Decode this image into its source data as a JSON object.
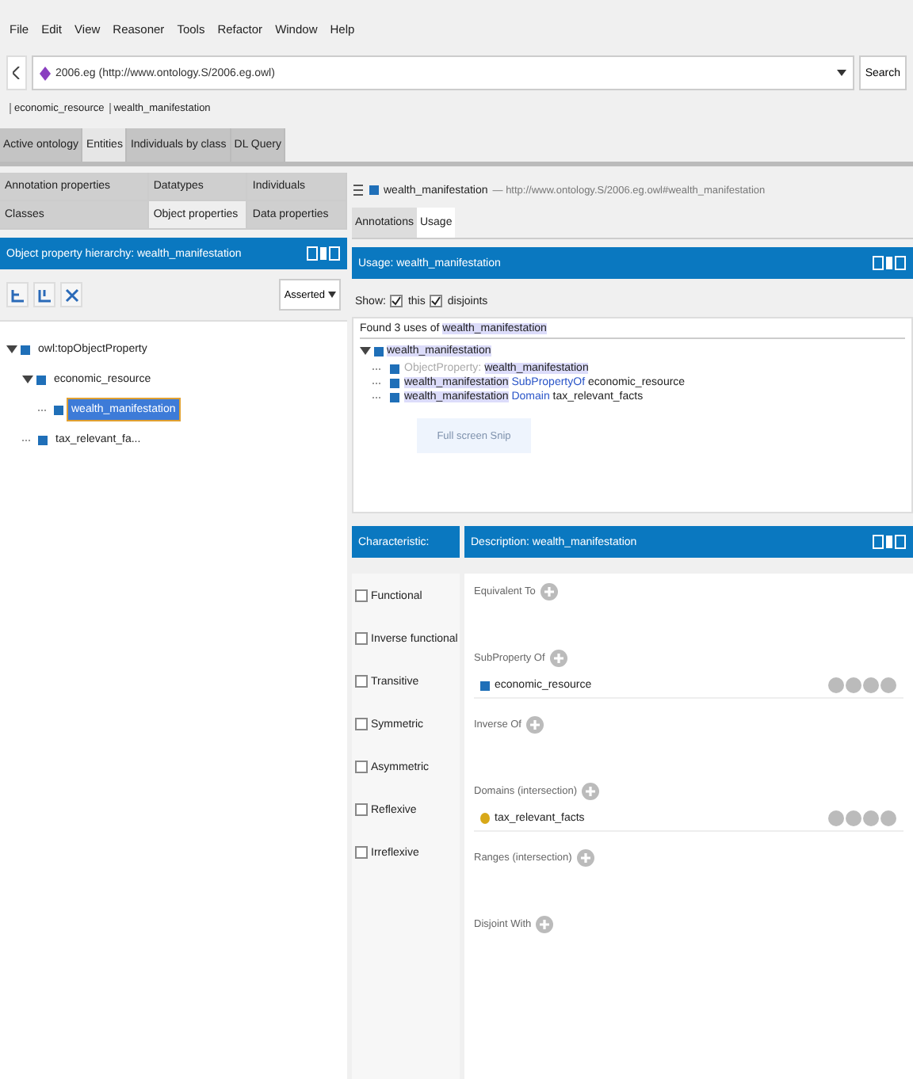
{
  "menu": [
    "File",
    "Edit",
    "View",
    "Reasoner",
    "Tools",
    "Refactor",
    "Window",
    "Help"
  ],
  "address": {
    "text": "2006.eg (http://www.ontology.S/2006.eg.owl)",
    "search": "Search"
  },
  "breadcrumb": [
    "economic_resource",
    "wealth_manifestation"
  ],
  "tabs": [
    {
      "label": "Active ontology",
      "selected": false
    },
    {
      "label": "Entities",
      "selected": true
    },
    {
      "label": "Individuals by class",
      "selected": false
    },
    {
      "label": "DL Query",
      "selected": false
    }
  ],
  "entity_tabs": [
    [
      {
        "label": "Annotation properties",
        "selected": false
      },
      {
        "label": "Datatypes",
        "selected": false
      },
      {
        "label": "Individuals",
        "selected": false
      }
    ],
    [
      {
        "label": "Classes",
        "selected": false
      },
      {
        "label": "Object properties",
        "selected": true
      },
      {
        "label": "Data properties",
        "selected": false
      }
    ]
  ],
  "hierarchy": {
    "title": "Object property hierarchy: wealth_manifestation",
    "mode": "Asserted",
    "tree": [
      {
        "label": "owl:topObjectProperty",
        "selected": false,
        "expanded": true,
        "children": [
          {
            "label": "economic_resource",
            "selected": false,
            "expanded": true,
            "children": [
              {
                "label": "wealth_manifestation",
                "selected": true
              }
            ]
          },
          {
            "label": "tax_relevant_fa...",
            "selected": false
          }
        ]
      }
    ]
  },
  "entity_header": {
    "name": "wealth_manifestation",
    "iri": "— http://www.ontology.S/2006.eg.owl#wealth_manifestation"
  },
  "right_tabs": [
    {
      "label": "Annotations",
      "selected": false
    },
    {
      "label": "Usage",
      "selected": true
    }
  ],
  "usage": {
    "title": "Usage: wealth_manifestation",
    "show": "Show:",
    "options": [
      {
        "label": "this",
        "checked": true
      },
      {
        "label": "disjoints",
        "checked": true
      }
    ],
    "found": [
      {
        "text": "Found 3 uses of ",
        "kind": "plain"
      },
      {
        "text": "wealth_manifestation",
        "kind": "entity"
      }
    ],
    "root": "wealth_manifestation",
    "rows": [
      [
        {
          "text": "ObjectProperty: ",
          "kind": "frame"
        },
        {
          "text": "wealth_manifestation",
          "kind": "entity"
        }
      ],
      [
        {
          "text": "wealth_manifestation",
          "kind": "entity"
        },
        {
          "text": " SubPropertyOf ",
          "kind": "keyword"
        },
        {
          "text": "economic_resource",
          "kind": "plain"
        }
      ],
      [
        {
          "text": "wealth_manifestation",
          "kind": "entity"
        },
        {
          "text": " Domain ",
          "kind": "keyword"
        },
        {
          "text": "tax_relevant_facts",
          "kind": "plain"
        }
      ]
    ],
    "snip": "Full screen Snip"
  },
  "characteristics": {
    "title": "Characteristic:",
    "items": [
      {
        "label": "Functional",
        "checked": false
      },
      {
        "label": "Inverse functional",
        "checked": false
      },
      {
        "label": "Transitive",
        "checked": false
      },
      {
        "label": "Symmetric",
        "checked": false
      },
      {
        "label": "Asymmetric",
        "checked": false
      },
      {
        "label": "Reflexive",
        "checked": false
      },
      {
        "label": "Irreflexive",
        "checked": false
      }
    ]
  },
  "description": {
    "title": "Description: wealth_manifestation",
    "sections": [
      {
        "label": "Equivalent To"
      },
      {
        "label": "SubProperty Of",
        "items": [
          {
            "text": "economic_resource",
            "kind": "property"
          }
        ]
      },
      {
        "label": "Inverse Of"
      },
      {
        "label": "Domains (intersection)",
        "items": [
          {
            "text": "tax_relevant_facts",
            "kind": "class"
          }
        ]
      },
      {
        "label": "Ranges (intersection)"
      },
      {
        "label": "Disjoint With"
      }
    ]
  }
}
